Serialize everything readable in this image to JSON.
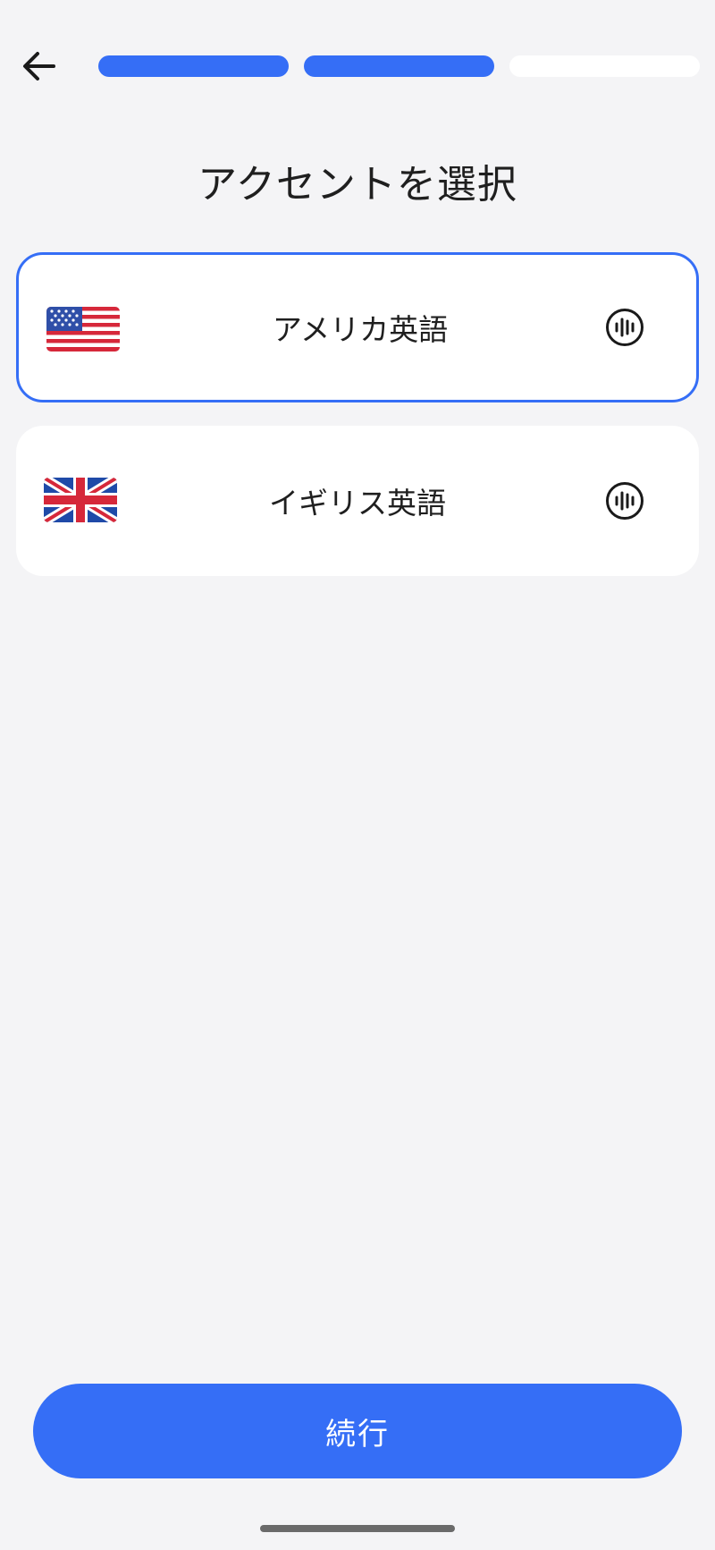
{
  "header": {
    "back_icon": "arrow-left-icon",
    "progress": {
      "total_steps": 3,
      "completed_steps": 2,
      "active_color": "#356ef6",
      "inactive_color": "#ffffff"
    }
  },
  "title": "アクセントを選択",
  "options": [
    {
      "label": "アメリカ英語",
      "flag_icon": "us-flag-icon",
      "audio_icon": "audio-wave-icon",
      "selected": true
    },
    {
      "label": "イギリス英語",
      "flag_icon": "uk-flag-icon",
      "audio_icon": "audio-wave-icon",
      "selected": false
    }
  ],
  "continue_label": "続行",
  "colors": {
    "accent": "#356ef6",
    "background": "#f4f4f6",
    "card": "#ffffff"
  }
}
